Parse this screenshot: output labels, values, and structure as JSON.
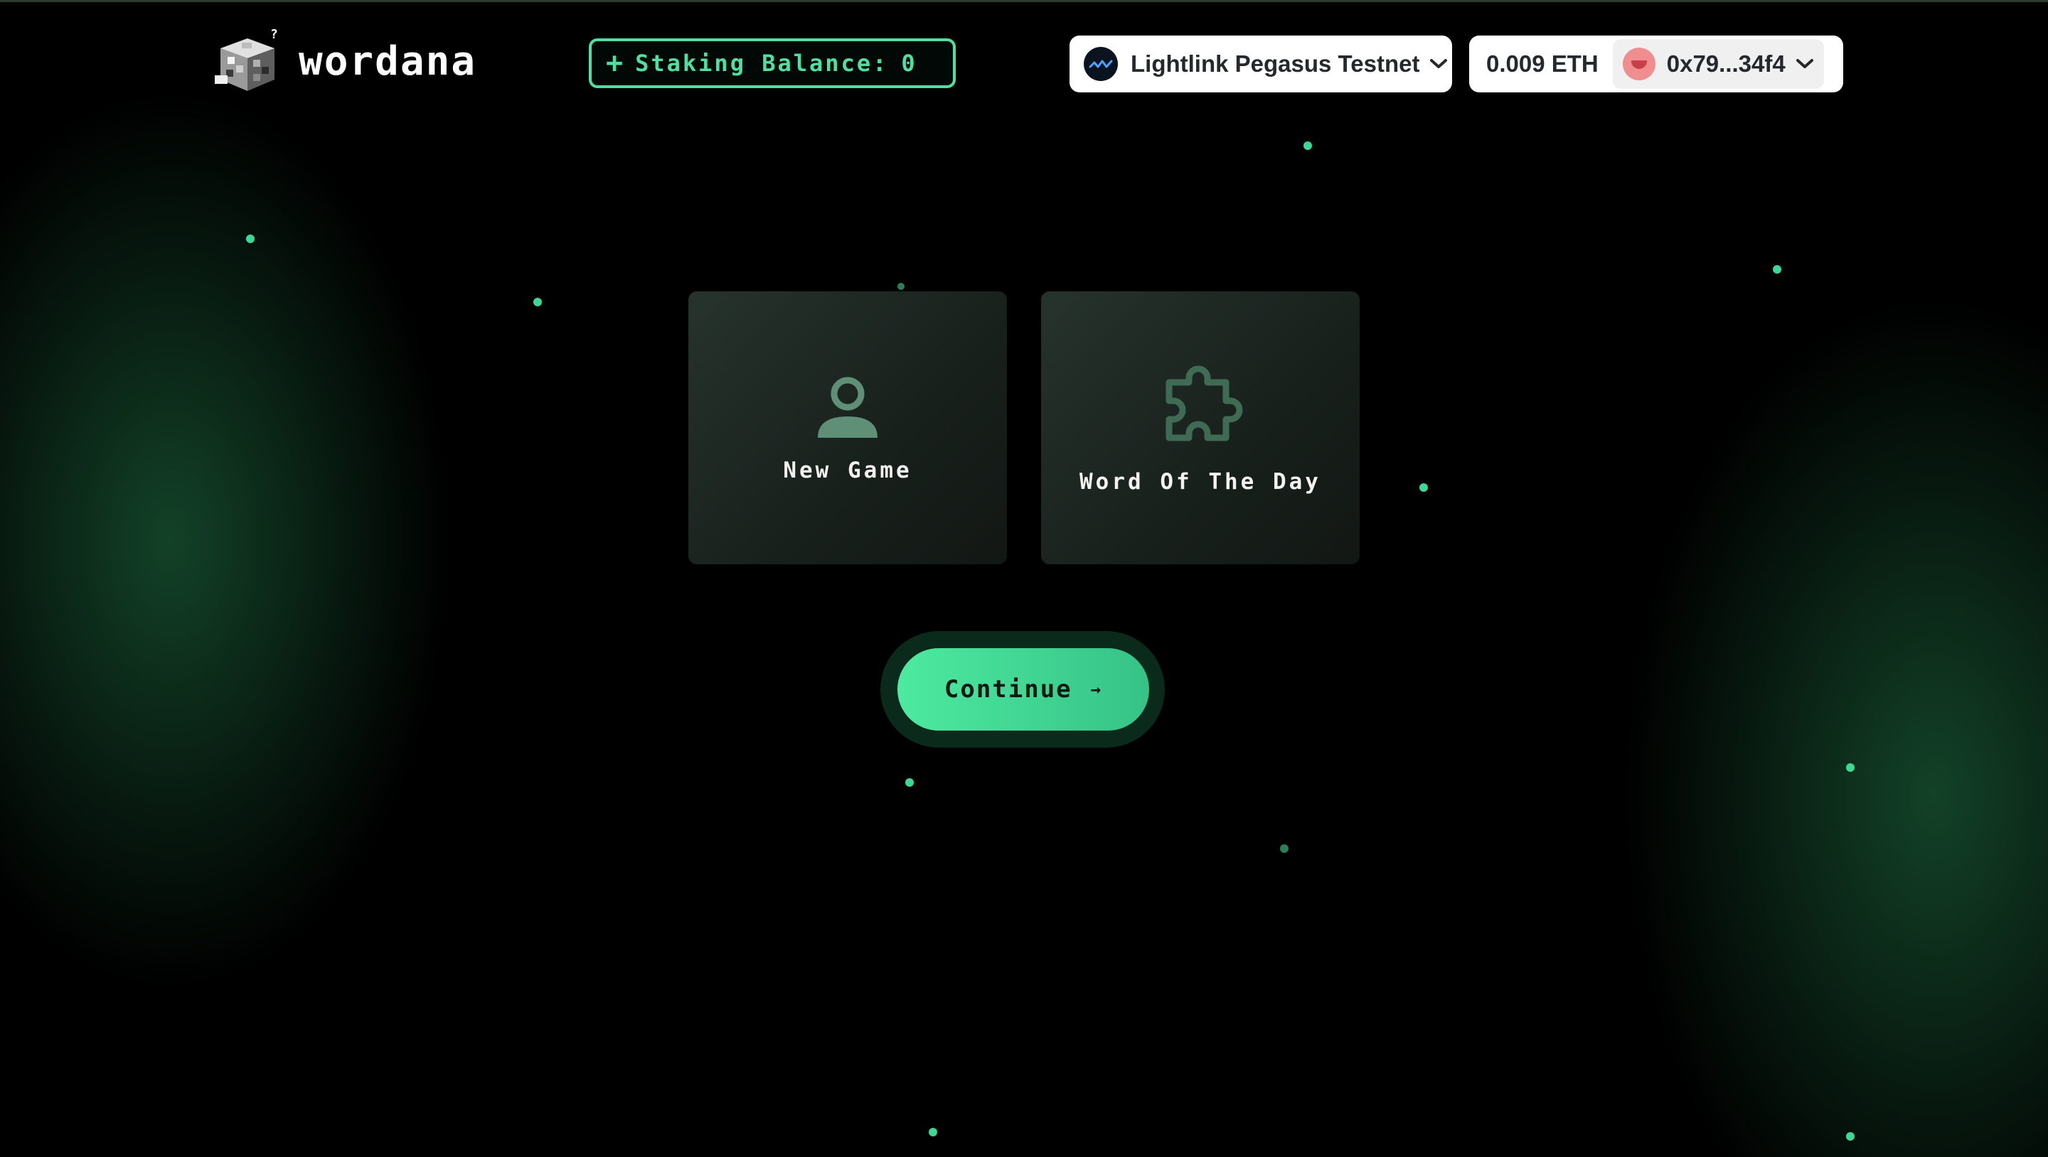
{
  "app": {
    "name": "Wordana"
  },
  "header": {
    "logo_text": "wordana",
    "staking": {
      "plus": "+",
      "label": "Staking Balance:",
      "value": "0"
    },
    "network": {
      "name": "Lightlink Pegasus Testnet",
      "icon": "lightlink-network-icon"
    },
    "account": {
      "balance": "0.009 ETH",
      "address": "0x79...34f4",
      "avatar": "avatar-icon"
    }
  },
  "modes": [
    {
      "label": "New Game",
      "icon": "user-icon"
    },
    {
      "label": "Word Of The Day",
      "icon": "puzzle-icon"
    }
  ],
  "continue": {
    "label": "Continue",
    "arrow": "→"
  },
  "colors": {
    "accent": "#4ee0a0",
    "card": "#1f2823",
    "background": "#000000"
  }
}
